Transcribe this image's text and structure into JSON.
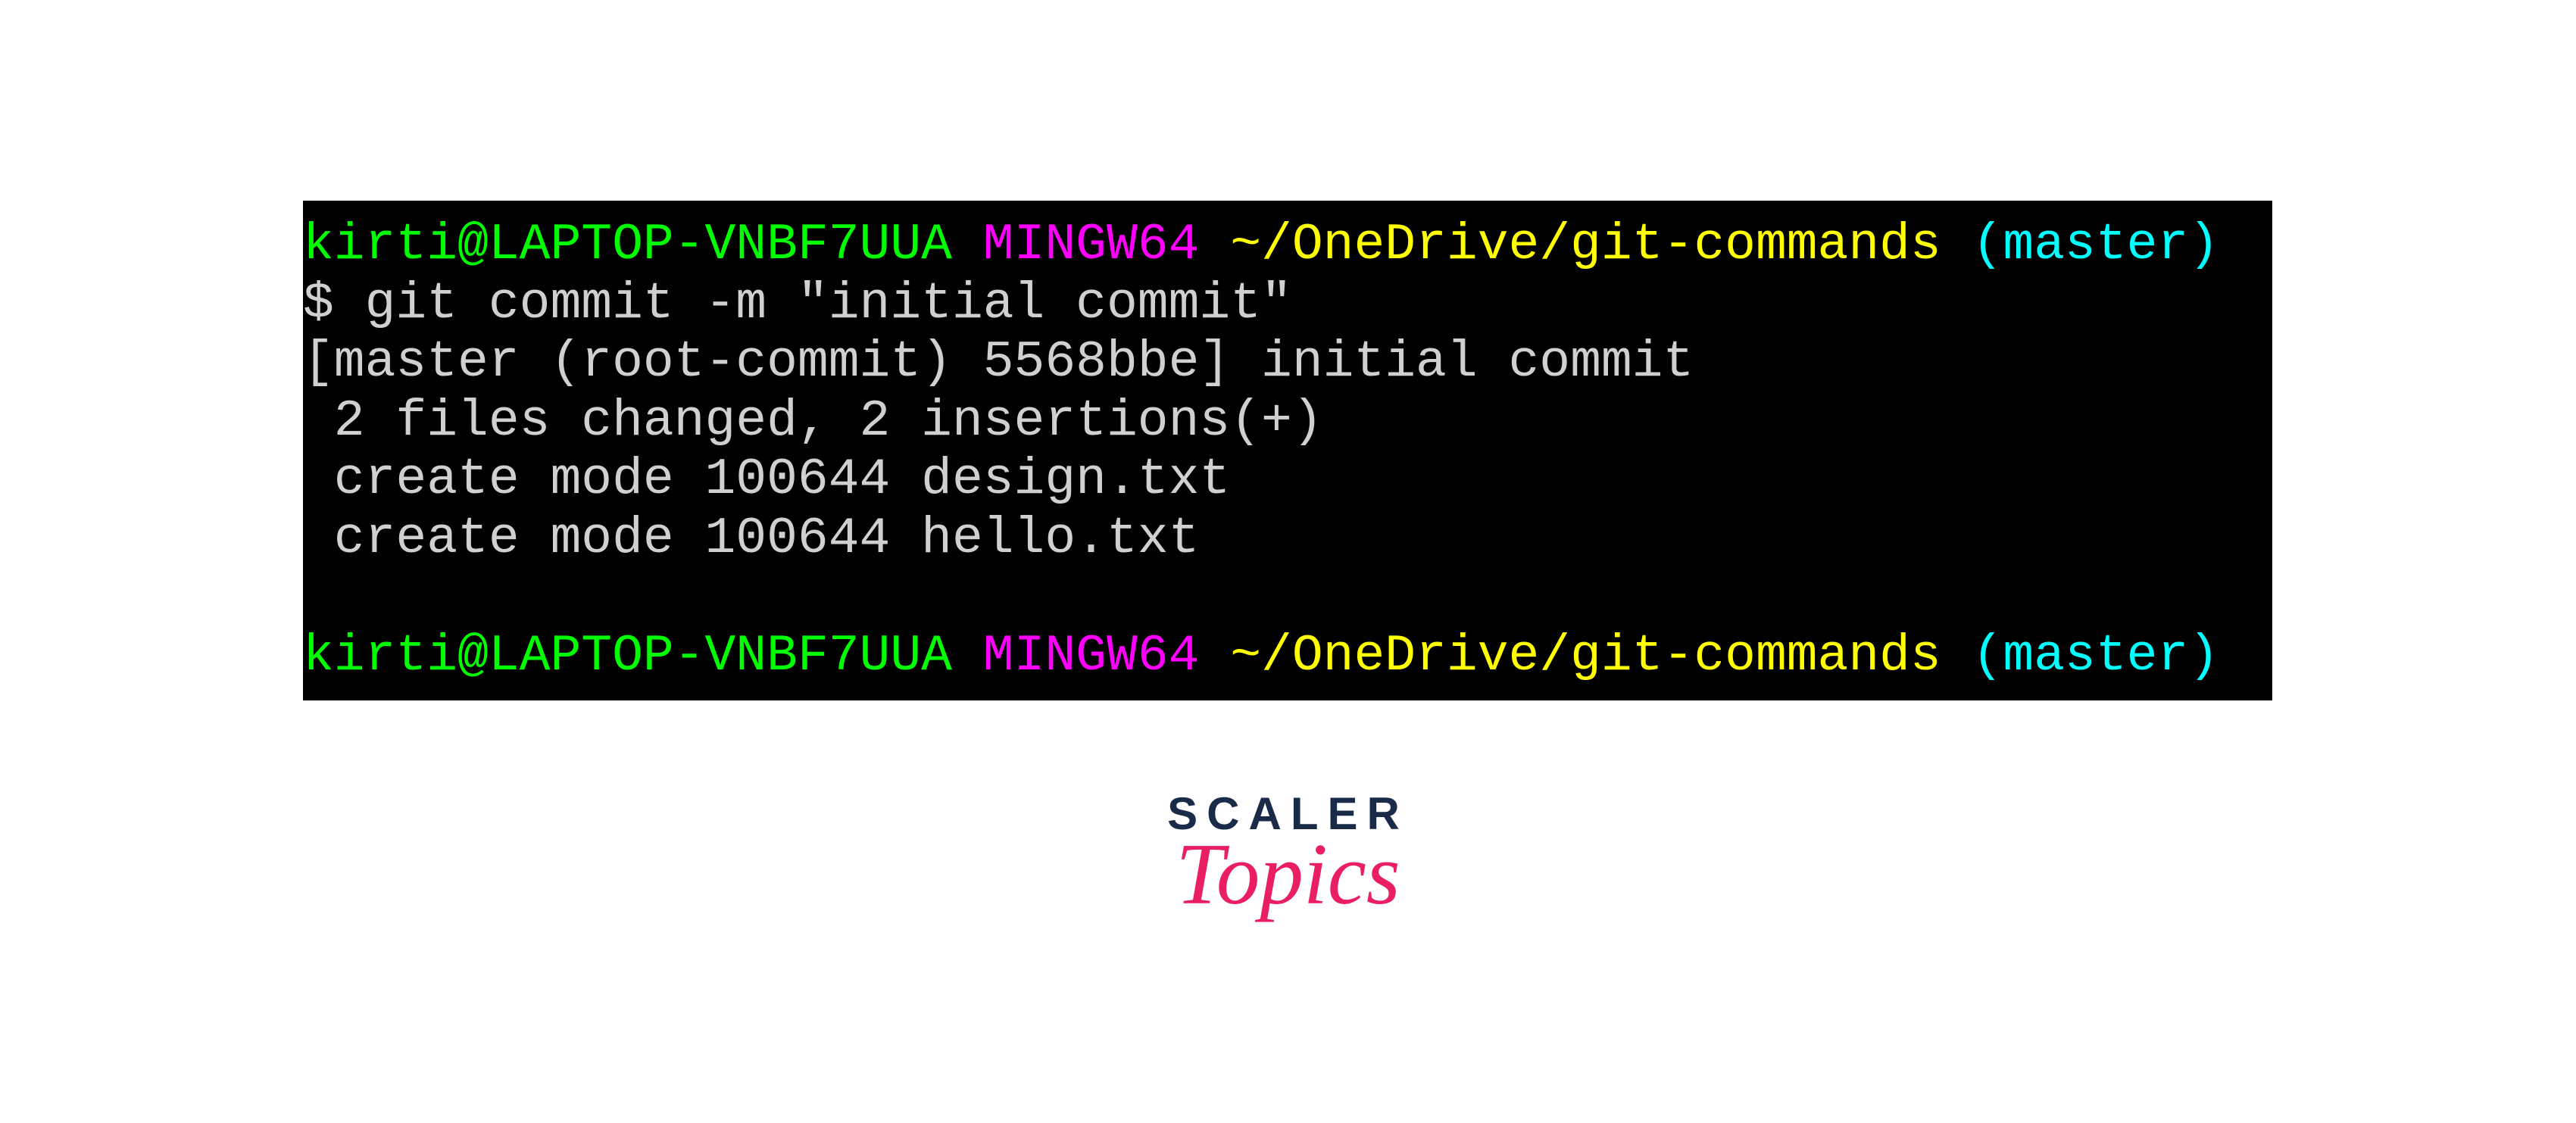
{
  "terminal": {
    "prompt1": {
      "user_host": "kirti@LAPTOP-VNBF7UUA",
      "mingw": "MINGW64",
      "path": "~/OneDrive/git-commands",
      "branch": "(master)"
    },
    "command": "$ git commit -m \"initial commit\"",
    "output": {
      "line1": "[master (root-commit) 5568bbe] initial commit",
      "line2": " 2 files changed, 2 insertions(+)",
      "line3": " create mode 100644 design.txt",
      "line4": " create mode 100644 hello.txt"
    },
    "prompt2": {
      "user_host": "kirti@LAPTOP-VNBF7UUA",
      "mingw": "MINGW64",
      "path": "~/OneDrive/git-commands",
      "branch": "(master)"
    }
  },
  "logo": {
    "line1": "SCALER",
    "line2": "Topics"
  }
}
